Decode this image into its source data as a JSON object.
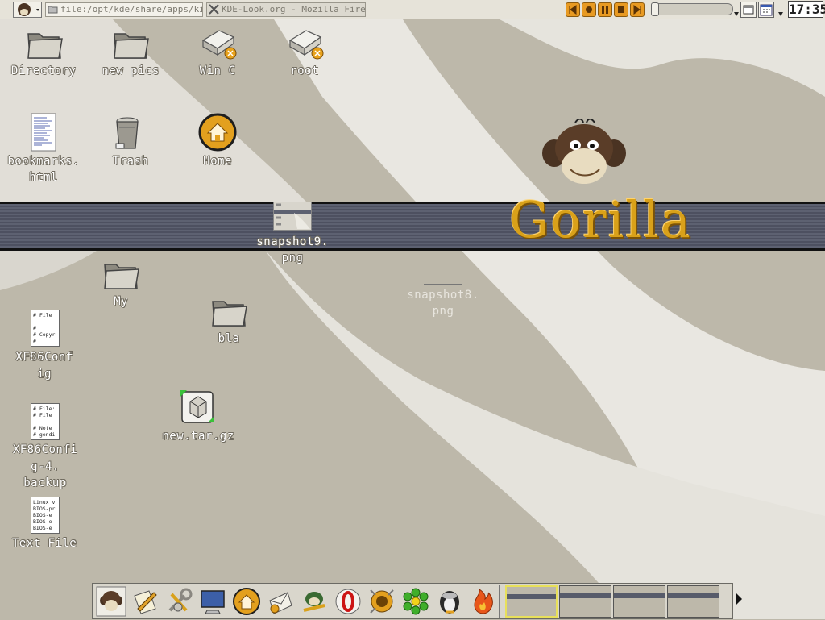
{
  "top_panel": {
    "tasks": [
      {
        "label": "file:/opt/kde/share/apps/kicke",
        "icon": "folder-icon"
      },
      {
        "label": "KDE-Look.org - Mozilla Firebi",
        "icon": "x-window-icon"
      }
    ],
    "clock": "17:35",
    "media_buttons": [
      "previous",
      "play",
      "pause",
      "stop",
      "next"
    ]
  },
  "wallpaper": {
    "title": "Gorilla"
  },
  "desktop_icons": [
    {
      "label": "Directory",
      "icon": "folder-icon"
    },
    {
      "label": "new pics",
      "icon": "folder-icon"
    },
    {
      "label": "Win C",
      "icon": "harddisk-icon"
    },
    {
      "label": "root",
      "icon": "harddisk-icon"
    },
    {
      "label": "bookmarks.",
      "label2": "html",
      "icon": "html-document-icon"
    },
    {
      "label": "Trash",
      "icon": "trash-icon"
    },
    {
      "label": "Home",
      "icon": "home-icon"
    },
    {
      "label": "snapshot9.",
      "label2": "png",
      "icon": "image-thumbnail-icon"
    },
    {
      "label": "snapshot8.",
      "label2": "png",
      "icon": "image-thumbnail-icon"
    },
    {
      "label": "My",
      "icon": "folder-icon"
    },
    {
      "label": "bla",
      "icon": "folder-icon"
    },
    {
      "label": "XF86Conf",
      "label2": "ig",
      "icon": "text-document-icon"
    },
    {
      "label": "new.tar.gz",
      "icon": "archive-icon"
    },
    {
      "label": "XF86Confi",
      "label2": "g-4.",
      "label3": "backup",
      "icon": "text-document-icon"
    },
    {
      "label": "Text File",
      "icon": "text-document-icon"
    }
  ],
  "doc_previews": {
    "xf86config": "# File\n\n#\n# Copyr\n#",
    "xf86backup": "# File:\n# File\n\n# Note\n# gendi",
    "textfile": "Linux v\nBIOS-pr\nBIOS-e\nBIOS-e\nBIOS-e"
  },
  "dock": {
    "launchers": [
      "gorilla-menu-icon",
      "editor-icon",
      "tools-icon",
      "monitor-icon",
      "home-icon",
      "mail-icon",
      "gaim-icon",
      "opera-icon",
      "sunflower-icon",
      "icq-icon",
      "tux-icon",
      "firefox-icon"
    ],
    "desktops": [
      1,
      2,
      3,
      4
    ],
    "active_desktop": 1
  },
  "colors": {
    "wallpaper_bg": "#bdb8aa",
    "wallpaper_light": "#e8e6df",
    "banner": "#555969",
    "title_gold": "#d9a11a"
  }
}
